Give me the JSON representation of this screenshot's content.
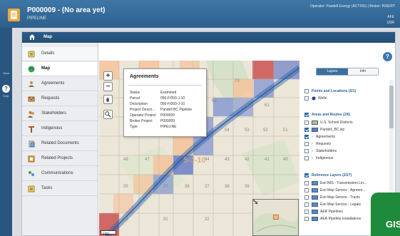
{
  "header": {
    "title": "P000009 - (No area yet)",
    "subtitle": "PIPELINE",
    "operator": "Operator: Pandell Energy (ACTIVE) | Broker: INSERT",
    "right_line1": "AFE",
    "right_line2": "USR"
  },
  "rail": {
    "save_label": "Save",
    "help_label": "Help",
    "help_icon": "?"
  },
  "tabbar": {
    "active_tab": "Map"
  },
  "nav": {
    "items": [
      {
        "label": "Details",
        "icon": "details-icon"
      },
      {
        "label": "Map",
        "icon": "globe-icon"
      },
      {
        "label": "Agreements",
        "icon": "agreements-icon"
      },
      {
        "label": "Requests",
        "icon": "requests-icon"
      },
      {
        "label": "Stakeholders",
        "icon": "stakeholders-icon"
      },
      {
        "label": "Indigenous",
        "icon": "indigenous-icon"
      },
      {
        "label": "Related Documents",
        "icon": "documents-icon"
      },
      {
        "label": "Related Projects",
        "icon": "projects-icon"
      },
      {
        "label": "Communications",
        "icon": "communications-icon"
      },
      {
        "label": "Tasks",
        "icon": "tasks-icon"
      }
    ]
  },
  "map": {
    "zoom_in": "+",
    "zoom_out": "−",
    "scale_label": "1 km",
    "grid_labels": [
      "74",
      "73",
      "72",
      "71",
      "70",
      "63",
      "64",
      "65",
      "66",
      "67",
      "68",
      "62",
      "61",
      "57",
      "58",
      "59",
      "60",
      "55",
      "54",
      "53",
      "52",
      "51",
      "48",
      "47",
      "46",
      "45",
      "44",
      "43",
      "42",
      "41",
      "40",
      "35",
      "36",
      "37",
      "38",
      "39",
      "34",
      "33",
      "32",
      "31",
      "30",
      "29"
    ],
    "highlight_label": "5-J-10"
  },
  "popup": {
    "title": "Agreements",
    "rows": [
      {
        "k": "Status",
        "v": "Examined"
      },
      {
        "k": "Parcel",
        "v": "056-F/093-J-10"
      },
      {
        "k": "Description",
        "v": "056-F/093-J-10"
      },
      {
        "k": "Project Descri...",
        "v": "Pandell BC Pipeline"
      },
      {
        "k": "Operator Project",
        "v": "P000009"
      },
      {
        "k": "Broker Project",
        "v": "P000009"
      },
      {
        "k": "Type",
        "v": "PIPELINE"
      }
    ]
  },
  "layers": {
    "help_icon": "?",
    "tab_layers": "Layers",
    "tab_info": "Info",
    "groups": [
      {
        "label": "Points and Locations (0/1)",
        "checked": false,
        "items": [
          {
            "label": "Wells",
            "checked": false,
            "swatch": "dot"
          }
        ]
      },
      {
        "label": "Areas and Routes (2/6)",
        "checked": true,
        "items": [
          {
            "label": "U.S. School Districts",
            "checked": false,
            "swatch": "green"
          },
          {
            "label": "Pandell_BC.zip",
            "checked": true,
            "swatch": "blue"
          },
          {
            "label": "Agreements",
            "checked": true,
            "swatch": "expand"
          },
          {
            "label": "Requests",
            "checked": false,
            "swatch": "expand"
          },
          {
            "label": "Stakeholders",
            "checked": false,
            "swatch": "expand"
          },
          {
            "label": "Indigenous",
            "checked": false,
            "swatch": "expand"
          }
        ]
      },
      {
        "label": "Reference Layers (2/27)",
        "checked": true,
        "items": [
          {
            "label": "Esri IMS - Transmission Lin...",
            "checked": false,
            "swatch": "esri"
          },
          {
            "label": "Esri Map Service - Agreem...",
            "checked": false,
            "swatch": "esri"
          },
          {
            "label": "Esri Map Service - Tracts",
            "checked": false,
            "swatch": "esri"
          },
          {
            "label": "Esri Map Service - Legals",
            "checked": false,
            "swatch": "esri"
          },
          {
            "label": "AER Pipelines",
            "checked": false,
            "swatch": "esri"
          },
          {
            "label": "AER Pipeline Installations",
            "checked": false,
            "swatch": "esri"
          }
        ]
      }
    ]
  },
  "badge": {
    "text": "GIS"
  },
  "colors": {
    "header": "#2d5f8c",
    "accent": "#3d6f9d",
    "pipeline": "#2f5fa8",
    "badge": "#1e8a3c"
  }
}
